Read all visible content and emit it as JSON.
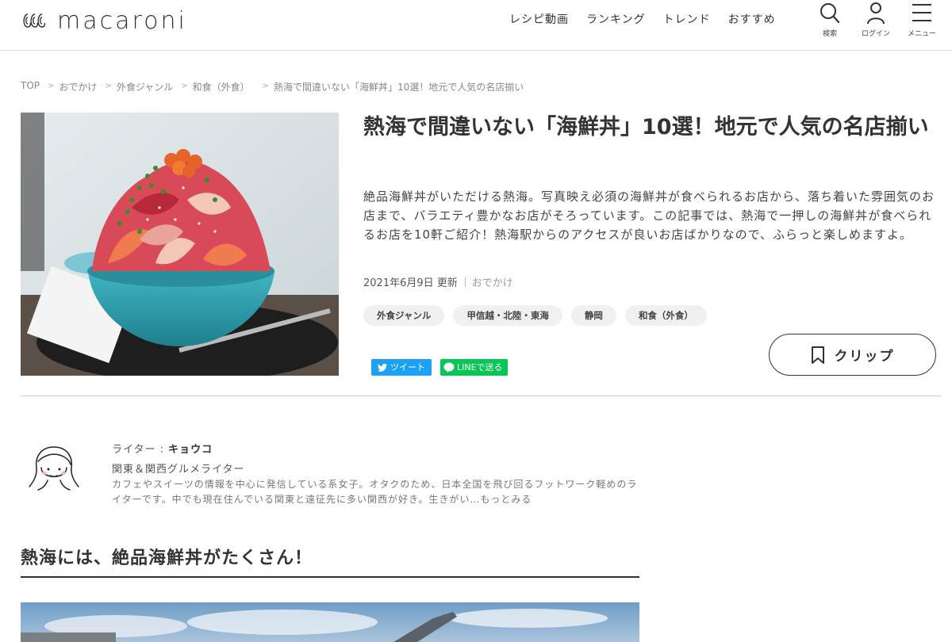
{
  "header": {
    "logo": "macaroni",
    "nav": [
      "レシピ動画",
      "ランキング",
      "トレンド",
      "おすすめ"
    ],
    "icons": [
      {
        "icon": "search-icon",
        "label": "検索"
      },
      {
        "icon": "user-icon",
        "label": "ログイン"
      },
      {
        "icon": "menu-icon",
        "label": "メニュー"
      }
    ]
  },
  "breadcrumb": [
    "TOP",
    "おでかけ",
    "外食ジャンル",
    "和食（外食）",
    "熱海で間違いない「海鮮丼」10選！地元で人気の名店揃い"
  ],
  "article": {
    "title": "熱海で間違いない「海鮮丼」10選！地元で人気の名店揃い",
    "description": "絶品海鮮丼がいただける熱海。写真映え必須の海鮮丼が食べられるお店から、落ち着いた雰囲気のお店まで、バラエティ豊かなお店がそろっています。この記事では、熱海で一押しの海鮮丼が食べられるお店を10軒ご紹介！熱海駅からのアクセスが良いお店ばかりなので、ふらっと楽しめますよ。",
    "date": "2021年6月9日 更新",
    "category": "おでかけ",
    "tags": [
      "外食ジャンル",
      "甲信越・北陸・東海",
      "静岡",
      "和食（外食）"
    ],
    "share": {
      "tweet": "ツイート",
      "line": "LINEで送る"
    },
    "clip": "クリップ"
  },
  "author": {
    "role_label": "ライター :",
    "name": "キョウコ",
    "title": "関東＆関西グルメライター",
    "bio": "カフェやスイーツの情報を中心に発信している系女子。オタクのため、日本全国を飛び回るフットワーク軽めのライターです。中でも現在住んでいる関東と遠征先に多い関西が好き。生きがい…もっとみる"
  },
  "section": {
    "heading": "熱海には、絶品海鮮丼がたくさん！"
  },
  "colors": {
    "twitter": "#1da1f2",
    "line": "#06c755",
    "tag_bg": "#f0f0f0",
    "text": "#333333"
  }
}
